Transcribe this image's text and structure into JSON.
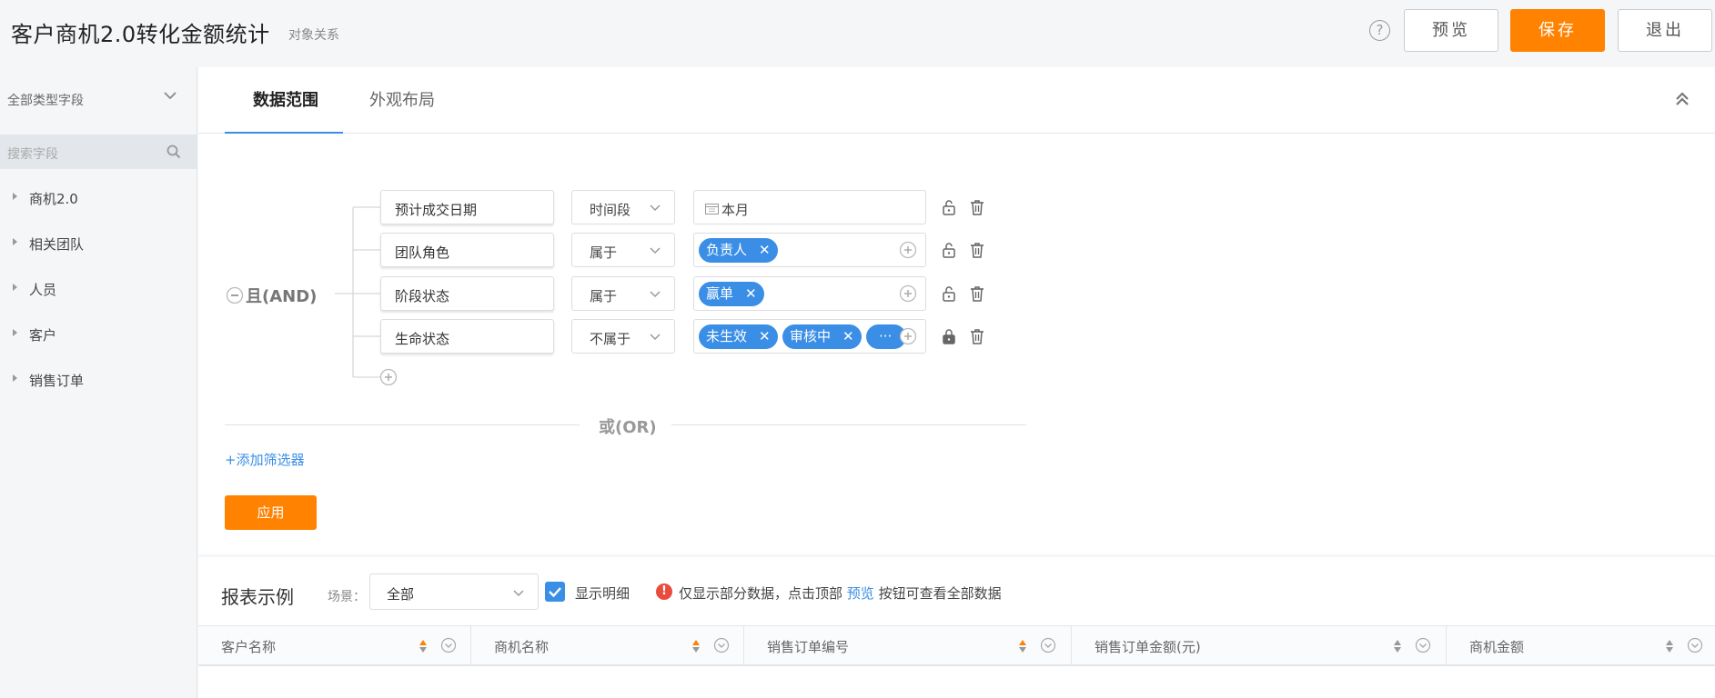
{
  "header": {
    "title": "客户商机2.0转化金额统计",
    "subtitle": "对象关系",
    "help_glyph": "?",
    "preview_label": "预览",
    "save_label": "保存",
    "exit_label": "退出"
  },
  "sidebar": {
    "field_type": "全部类型字段",
    "search_placeholder": "搜索字段",
    "items": [
      {
        "label": "商机2.0"
      },
      {
        "label": "相关团队"
      },
      {
        "label": "人员"
      },
      {
        "label": "客户"
      },
      {
        "label": "销售订单"
      }
    ]
  },
  "tabs": [
    {
      "label": "数据范围",
      "active": true
    },
    {
      "label": "外观布局",
      "active": false
    }
  ],
  "filter": {
    "group_label": "且(AND)",
    "or_label": "或(OR)",
    "add_filter_label": "+添加筛选器",
    "apply_label": "应用",
    "rows": [
      {
        "field": "预计成交日期",
        "operator": "时间段",
        "value_text": "本月",
        "chips": []
      },
      {
        "field": "团队角色",
        "operator": "属于",
        "value_text": "",
        "chips": [
          "负责人"
        ]
      },
      {
        "field": "阶段状态",
        "operator": "属于",
        "value_text": "",
        "chips": [
          "赢单"
        ]
      },
      {
        "field": "生命状态",
        "operator": "不属于",
        "value_text": "",
        "chips": [
          "未生效",
          "审核中",
          "···"
        ]
      }
    ],
    "chip_close_glyph": "✕"
  },
  "report": {
    "title": "报表示例",
    "scene_label": "场景：",
    "scene_value": "全部",
    "show_detail_label": "显示明细",
    "show_detail_checked": true,
    "warn_glyph": "!",
    "notice_before": "仅显示部分数据，点击顶部",
    "notice_link": "预览",
    "notice_after": "按钮可查看全部数据",
    "columns": [
      "客户名称",
      "商机名称",
      "销售订单编号",
      "销售订单金额(元)",
      "商机金额"
    ]
  },
  "colors": {
    "accent": "#3a8ee6",
    "primary": "#ff8200",
    "warning": "#e84c3d"
  }
}
